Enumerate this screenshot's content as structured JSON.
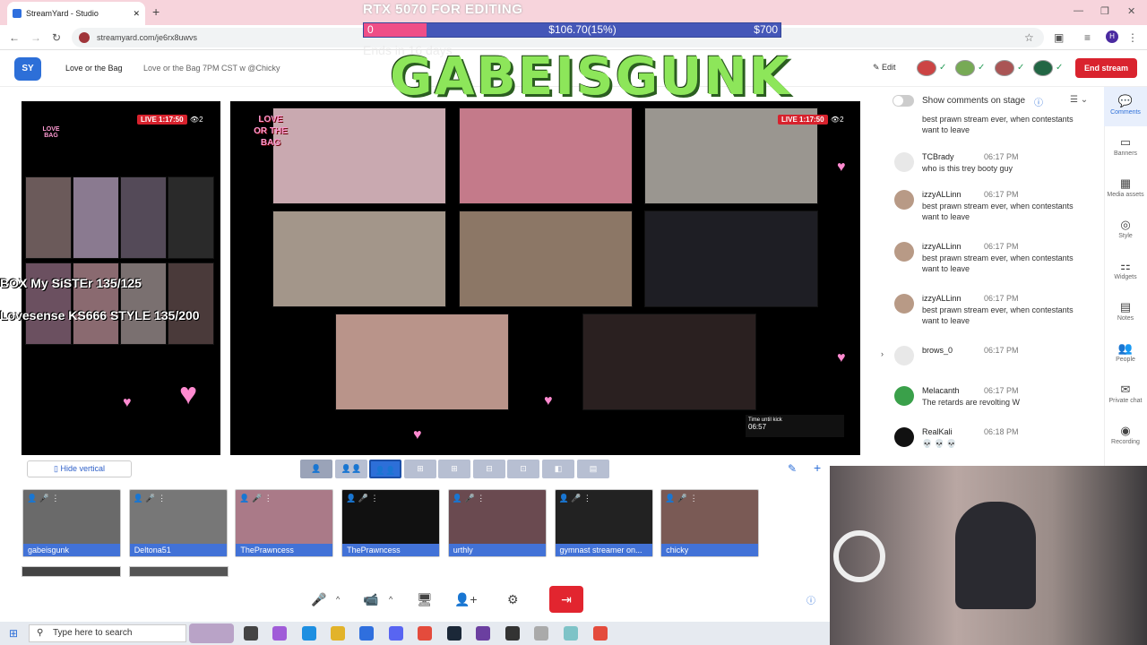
{
  "browser": {
    "tab_title": "StreamYard - Studio",
    "url": "streamyard.com/je6rx8uwvs"
  },
  "header": {
    "broadcast_title": "Love or the Bag",
    "broadcast_subtitle": "Love or the Bag 7PM CST w @Chicky",
    "edit_label": "Edit",
    "end_stream_label": "End stream"
  },
  "overlay": {
    "goal_title": "RTX 5070 FOR EDITING",
    "goal_start": "0",
    "goal_current": "$106.70(15%)",
    "goal_end": "$700",
    "goal_fraction": 0.15,
    "goal_subtitle": "Ends in 16 days",
    "streamer_name": "GABEISGUNK"
  },
  "stage": {
    "live_timer": "LIVE 1:17:50",
    "viewer_count": "2",
    "left_overlay_line1": "BOX My SiSTEr 135/125",
    "left_overlay_line2": "Lovesense KS666 STYLE 135/200",
    "kick_timer_label": "Time until kick",
    "kick_timer_value": "06:57"
  },
  "chat": {
    "show_comments_label": "Show comments on stage",
    "messages": [
      {
        "name": "",
        "time": "",
        "text": "best prawn stream ever, when contestants want to leave"
      },
      {
        "name": "TCBrady",
        "time": "06:17 PM",
        "text": "who is this trey booty guy"
      },
      {
        "name": "izzyALLinn",
        "time": "06:17 PM",
        "text": "best prawn stream ever, when contestants want to leave"
      },
      {
        "name": "izzyALLinn",
        "time": "06:17 PM",
        "text": "best prawn stream ever, when contestants want to leave"
      },
      {
        "name": "izzyALLinn",
        "time": "06:17 PM",
        "text": "best prawn stream ever, when contestants want to leave"
      },
      {
        "name": "brows_0",
        "time": "06:17 PM",
        "text": ""
      },
      {
        "name": "Melacanth",
        "time": "06:17 PM",
        "text": "The retards are revolting W"
      },
      {
        "name": "RealKali",
        "time": "06:18 PM",
        "text": "💀 💀 💀"
      }
    ]
  },
  "sidebar": {
    "items": [
      "Comments",
      "Banners",
      "Media assets",
      "Style",
      "Widgets",
      "Notes",
      "People",
      "Private chat",
      "Recording"
    ]
  },
  "layout_bar": {
    "hide_vertical_label": "Hide vertical"
  },
  "guests": [
    {
      "name": "gabeisgunk"
    },
    {
      "name": "Deltona51"
    },
    {
      "name": "ThePrawncess"
    },
    {
      "name": "ThePrawncess"
    },
    {
      "name": "urthly"
    },
    {
      "name": "gymnast streamer on..."
    },
    {
      "name": "chicky"
    }
  ],
  "taskbar": {
    "search_placeholder": "Type here to search"
  },
  "colors": {
    "accent": "#4272d7",
    "end_stream": "#d9232e",
    "goal_bar": "#4557b8",
    "goal_fill": "#ef4e87"
  }
}
